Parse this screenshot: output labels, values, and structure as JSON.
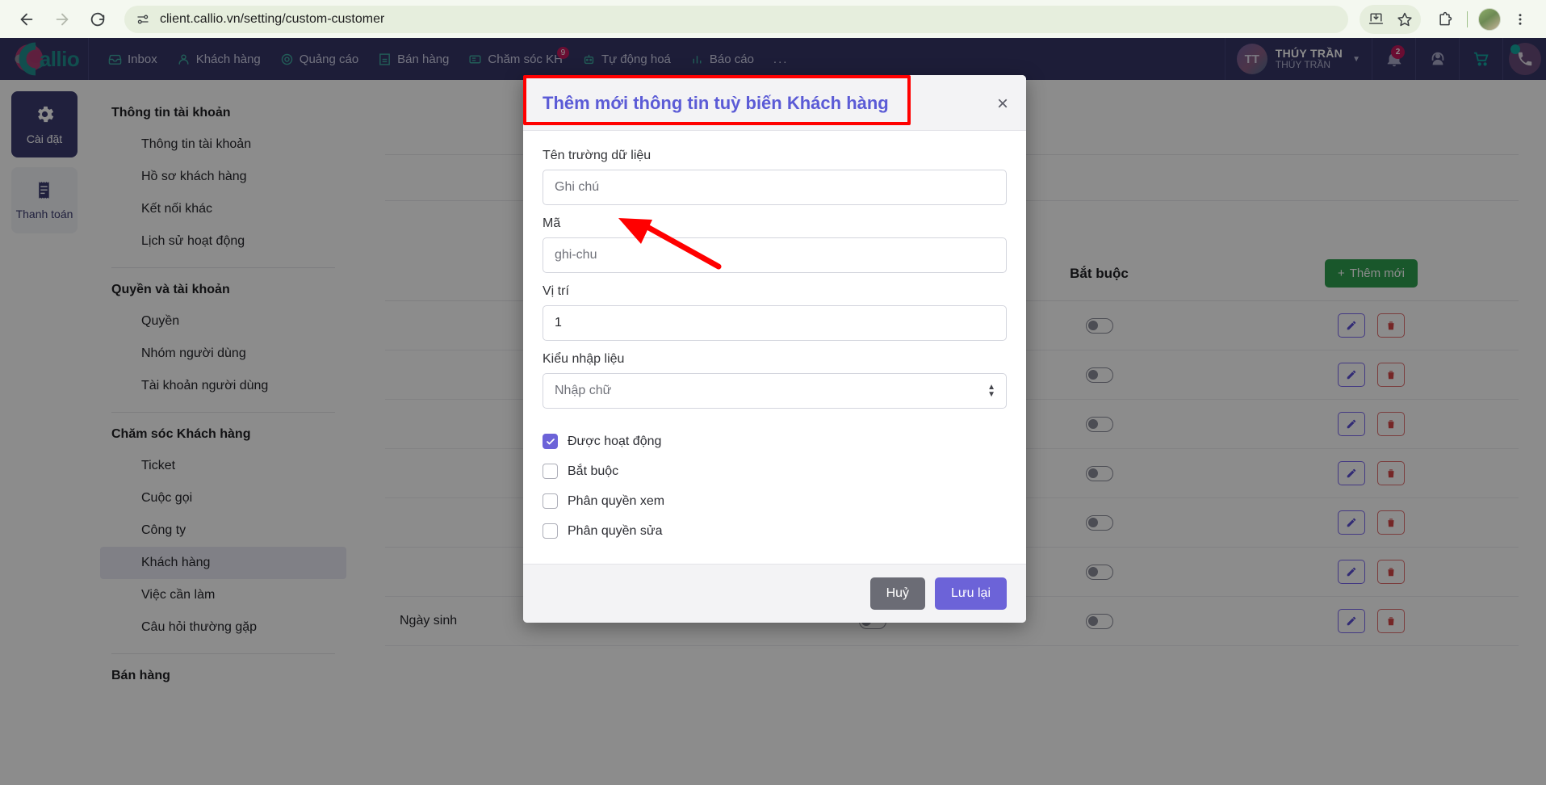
{
  "browser": {
    "url": "client.callio.vn/setting/custom-customer",
    "back_icon": "back-arrow-icon",
    "forward_icon": "forward-arrow-icon",
    "reload_icon": "reload-icon",
    "site_info_icon": "site-settings-icon",
    "install_icon": "install-app-icon",
    "bookmark_icon": "star-icon",
    "extensions_icon": "extensions-puzzle-icon",
    "menu_icon": "three-dot-menu-icon"
  },
  "appbar": {
    "logo_text": "allio",
    "nav": [
      {
        "label": "Inbox",
        "icon": "inbox-icon",
        "badge": ""
      },
      {
        "label": "Khách hàng",
        "icon": "customer-icon",
        "badge": ""
      },
      {
        "label": "Quảng cáo",
        "icon": "ads-target-icon",
        "badge": ""
      },
      {
        "label": "Bán hàng",
        "icon": "building-icon",
        "badge": ""
      },
      {
        "label": "Chăm sóc KH",
        "icon": "ticket-icon",
        "badge": "9"
      },
      {
        "label": "Tự động hoá",
        "icon": "automation-icon",
        "badge": ""
      },
      {
        "label": "Báo cáo",
        "icon": "report-icon",
        "badge": ""
      },
      {
        "label": "...",
        "icon": "more-icon",
        "badge": ""
      }
    ],
    "user": {
      "initials": "TT",
      "name": "THÚY TRẦN",
      "subname": "THÚY TRẦN",
      "caret_icon": "chevron-down-icon"
    },
    "notification_count": "2",
    "notification_icon": "bell-icon",
    "support_icon": "headset-agent-icon",
    "cart_icon": "shopping-cart-icon",
    "phone_icon": "phone-call-icon"
  },
  "rail": [
    {
      "label": "Cài đặt",
      "icon": "gear-icon",
      "active": true
    },
    {
      "label": "Thanh toán",
      "icon": "receipt-icon",
      "active": false
    }
  ],
  "submenu": [
    {
      "type": "group",
      "label": "Thông tin tài khoản"
    },
    {
      "type": "item",
      "label": "Thông tin tài khoản",
      "active": false
    },
    {
      "type": "item",
      "label": "Hồ sơ khách hàng",
      "active": false
    },
    {
      "type": "item",
      "label": "Kết nối khác",
      "active": false
    },
    {
      "type": "item",
      "label": "Lịch sử hoạt động",
      "active": false
    },
    {
      "type": "sep"
    },
    {
      "type": "group",
      "label": "Quyền và tài khoản"
    },
    {
      "type": "item",
      "label": "Quyền",
      "active": false
    },
    {
      "type": "item",
      "label": "Nhóm người dùng",
      "active": false
    },
    {
      "type": "item",
      "label": "Tài khoản người dùng",
      "active": false
    },
    {
      "type": "sep"
    },
    {
      "type": "group",
      "label": "Chăm sóc Khách hàng"
    },
    {
      "type": "item",
      "label": "Ticket",
      "active": false
    },
    {
      "type": "item",
      "label": "Cuộc gọi",
      "active": false
    },
    {
      "type": "item",
      "label": "Công ty",
      "active": false
    },
    {
      "type": "item",
      "label": "Khách hàng",
      "active": true
    },
    {
      "type": "item",
      "label": "Việc cần làm",
      "active": false
    },
    {
      "type": "item",
      "label": "Câu hỏi thường gặp",
      "active": false
    },
    {
      "type": "sep"
    },
    {
      "type": "group",
      "label": "Bán hàng"
    }
  ],
  "table": {
    "add_button": "Thêm mới",
    "add_icon": "plus-icon",
    "headers": [
      "",
      "",
      "Bắt buộc",
      ""
    ],
    "rows": [
      {
        "name": "",
        "toggle1": false,
        "toggle2": false
      },
      {
        "name": "",
        "toggle1": false,
        "toggle2": false
      },
      {
        "name": "",
        "toggle1": false,
        "toggle2": false
      },
      {
        "name": "",
        "toggle1": false,
        "toggle2": false
      },
      {
        "name": "",
        "toggle1": false,
        "toggle2": false
      },
      {
        "name": "",
        "toggle1": false,
        "toggle2": false
      },
      {
        "name": "Ngày sinh",
        "toggle1": true,
        "toggle2": true
      }
    ],
    "edit_icon": "pencil-icon",
    "delete_icon": "trash-icon"
  },
  "modal": {
    "title": "Thêm mới thông tin tuỳ biến Khách hàng",
    "close_icon": "close-icon",
    "fields": [
      {
        "label": "Tên trường dữ liệu",
        "value": "",
        "placeholder": "Ghi chú",
        "filled": false
      },
      {
        "label": "Mã",
        "value": "",
        "placeholder": "ghi-chu",
        "filled": false
      },
      {
        "label": "Vị trí",
        "value": "1",
        "placeholder": "",
        "filled": true
      }
    ],
    "select": {
      "label": "Kiểu nhập liệu",
      "value": "Nhập chữ",
      "arrow_icon": "select-stepper-icon"
    },
    "checkboxes": [
      {
        "label": "Được hoạt động",
        "checked": true
      },
      {
        "label": "Bắt buộc",
        "checked": false
      },
      {
        "label": "Phân quyền xem",
        "checked": false
      },
      {
        "label": "Phân quyền sửa",
        "checked": false
      }
    ],
    "cancel_label": "Huỷ",
    "save_label": "Lưu lại"
  },
  "annotations": {
    "highlight_color": "#ff0000",
    "arrow_target": "Ghi chú input field",
    "rect_target": "modal title"
  }
}
